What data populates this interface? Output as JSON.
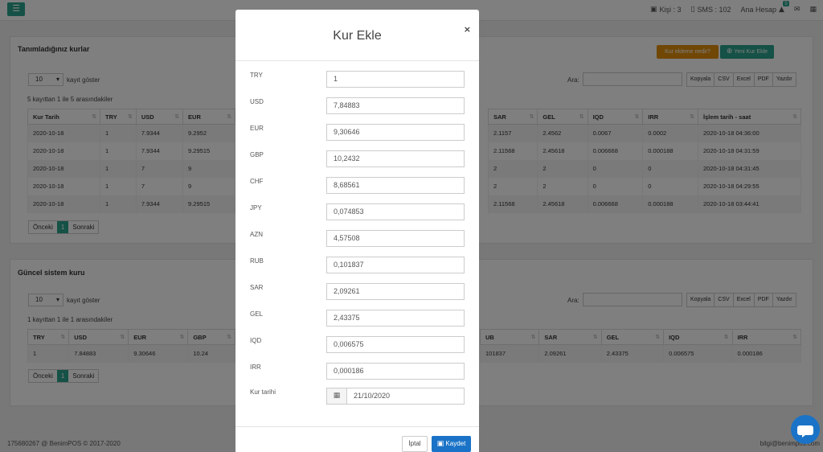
{
  "topbar": {
    "menu_icon": "☰",
    "persons": "Kişi : 3",
    "sms": "SMS : 102",
    "account": "Ana Hesap",
    "account_badge": "5"
  },
  "panel1": {
    "title": "Tanımladığınız kurlar",
    "btn_info": "Kur ekleme nedir?",
    "btn_add": "Yeni Kur Ekle",
    "page_size": "10",
    "page_size_label": "kayıt göster",
    "search_label": "Ara:",
    "export": [
      "Kopyala",
      "CSV",
      "Excel",
      "PDF",
      "Yazdır"
    ],
    "info": "5 kayıttan 1 ile 5 arasındakiler",
    "columns_left": [
      "Kur Tarih",
      "TRY",
      "USD",
      "EUR"
    ],
    "columns_right": [
      "SAR",
      "GEL",
      "IQD",
      "IRR",
      "İşlem tarih - saat"
    ],
    "rows": [
      {
        "left": [
          "2020-10-18",
          "1",
          "7.9344",
          "9.2952"
        ],
        "right": [
          "2.1157",
          "2.4562",
          "0.0067",
          "0.0002",
          "2020-10-18 04:36:00"
        ]
      },
      {
        "left": [
          "2020-10-18",
          "1",
          "7.9344",
          "9.29515"
        ],
        "right": [
          "2.11568",
          "2.45618",
          "0.006668",
          "0.000188",
          "2020-10-18 04:31:59"
        ]
      },
      {
        "left": [
          "2020-10-18",
          "1",
          "7",
          "9"
        ],
        "right": [
          "2",
          "2",
          "0",
          "0",
          "2020-10-18 04:31:45"
        ]
      },
      {
        "left": [
          "2020-10-18",
          "1",
          "7",
          "9"
        ],
        "right": [
          "2",
          "2",
          "0",
          "0",
          "2020-10-18 04:29:55"
        ]
      },
      {
        "left": [
          "2020-10-18",
          "1",
          "7.9344",
          "9.29515"
        ],
        "right": [
          "2.11568",
          "2.45618",
          "0.006668",
          "0.000188",
          "2020-10-18 03:44:41"
        ]
      }
    ],
    "prev": "Önceki",
    "page": "1",
    "next": "Sonraki"
  },
  "panel2": {
    "title": "Güncel sistem kuru",
    "page_size": "10",
    "page_size_label": "kayıt göster",
    "search_label": "Ara:",
    "export": [
      "Kopyala",
      "CSV",
      "Excel",
      "PDF",
      "Yazdır"
    ],
    "info": "1 kayıttan 1 ile 1 arasındakiler",
    "columns_left": [
      "TRY",
      "USD",
      "EUR",
      "GBP"
    ],
    "columns_right": [
      "UB",
      "SAR",
      "GEL",
      "IQD",
      "IRR"
    ],
    "row_left": [
      "1",
      "7.84883",
      "9.30646",
      "10.24"
    ],
    "row_right": [
      "101837",
      "2.09261",
      "2.43375",
      "0.006575",
      "0.000186"
    ],
    "prev": "Önceki",
    "page": "1",
    "next": "Sonraki"
  },
  "footer": {
    "left": "175680267 @ BenimPOS © 2017-2020",
    "right": "bilgi@benimpos.com"
  },
  "modal": {
    "title": "Kur Ekle",
    "close": "×",
    "fields": [
      {
        "label": "TRY",
        "value": "1"
      },
      {
        "label": "USD",
        "value": "7,84883"
      },
      {
        "label": "EUR",
        "value": "9,30646"
      },
      {
        "label": "GBP",
        "value": "10,2432"
      },
      {
        "label": "CHF",
        "value": "8,68561"
      },
      {
        "label": "JPY",
        "value": "0,074853"
      },
      {
        "label": "AZN",
        "value": "4,57508"
      },
      {
        "label": "RUB",
        "value": "0,101837"
      },
      {
        "label": "SAR",
        "value": "2,09261"
      },
      {
        "label": "GEL",
        "value": "2,43375"
      },
      {
        "label": "IQD",
        "value": "0,006575"
      },
      {
        "label": "IRR",
        "value": "0,000186"
      }
    ],
    "date_label": "Kur tarihi",
    "date_value": "21/10/2020",
    "cancel": "İptal",
    "save": "Kaydet"
  },
  "colors": {
    "accent": "#2aa38c",
    "orange": "#e08e0b",
    "primary": "#1a73c7"
  }
}
